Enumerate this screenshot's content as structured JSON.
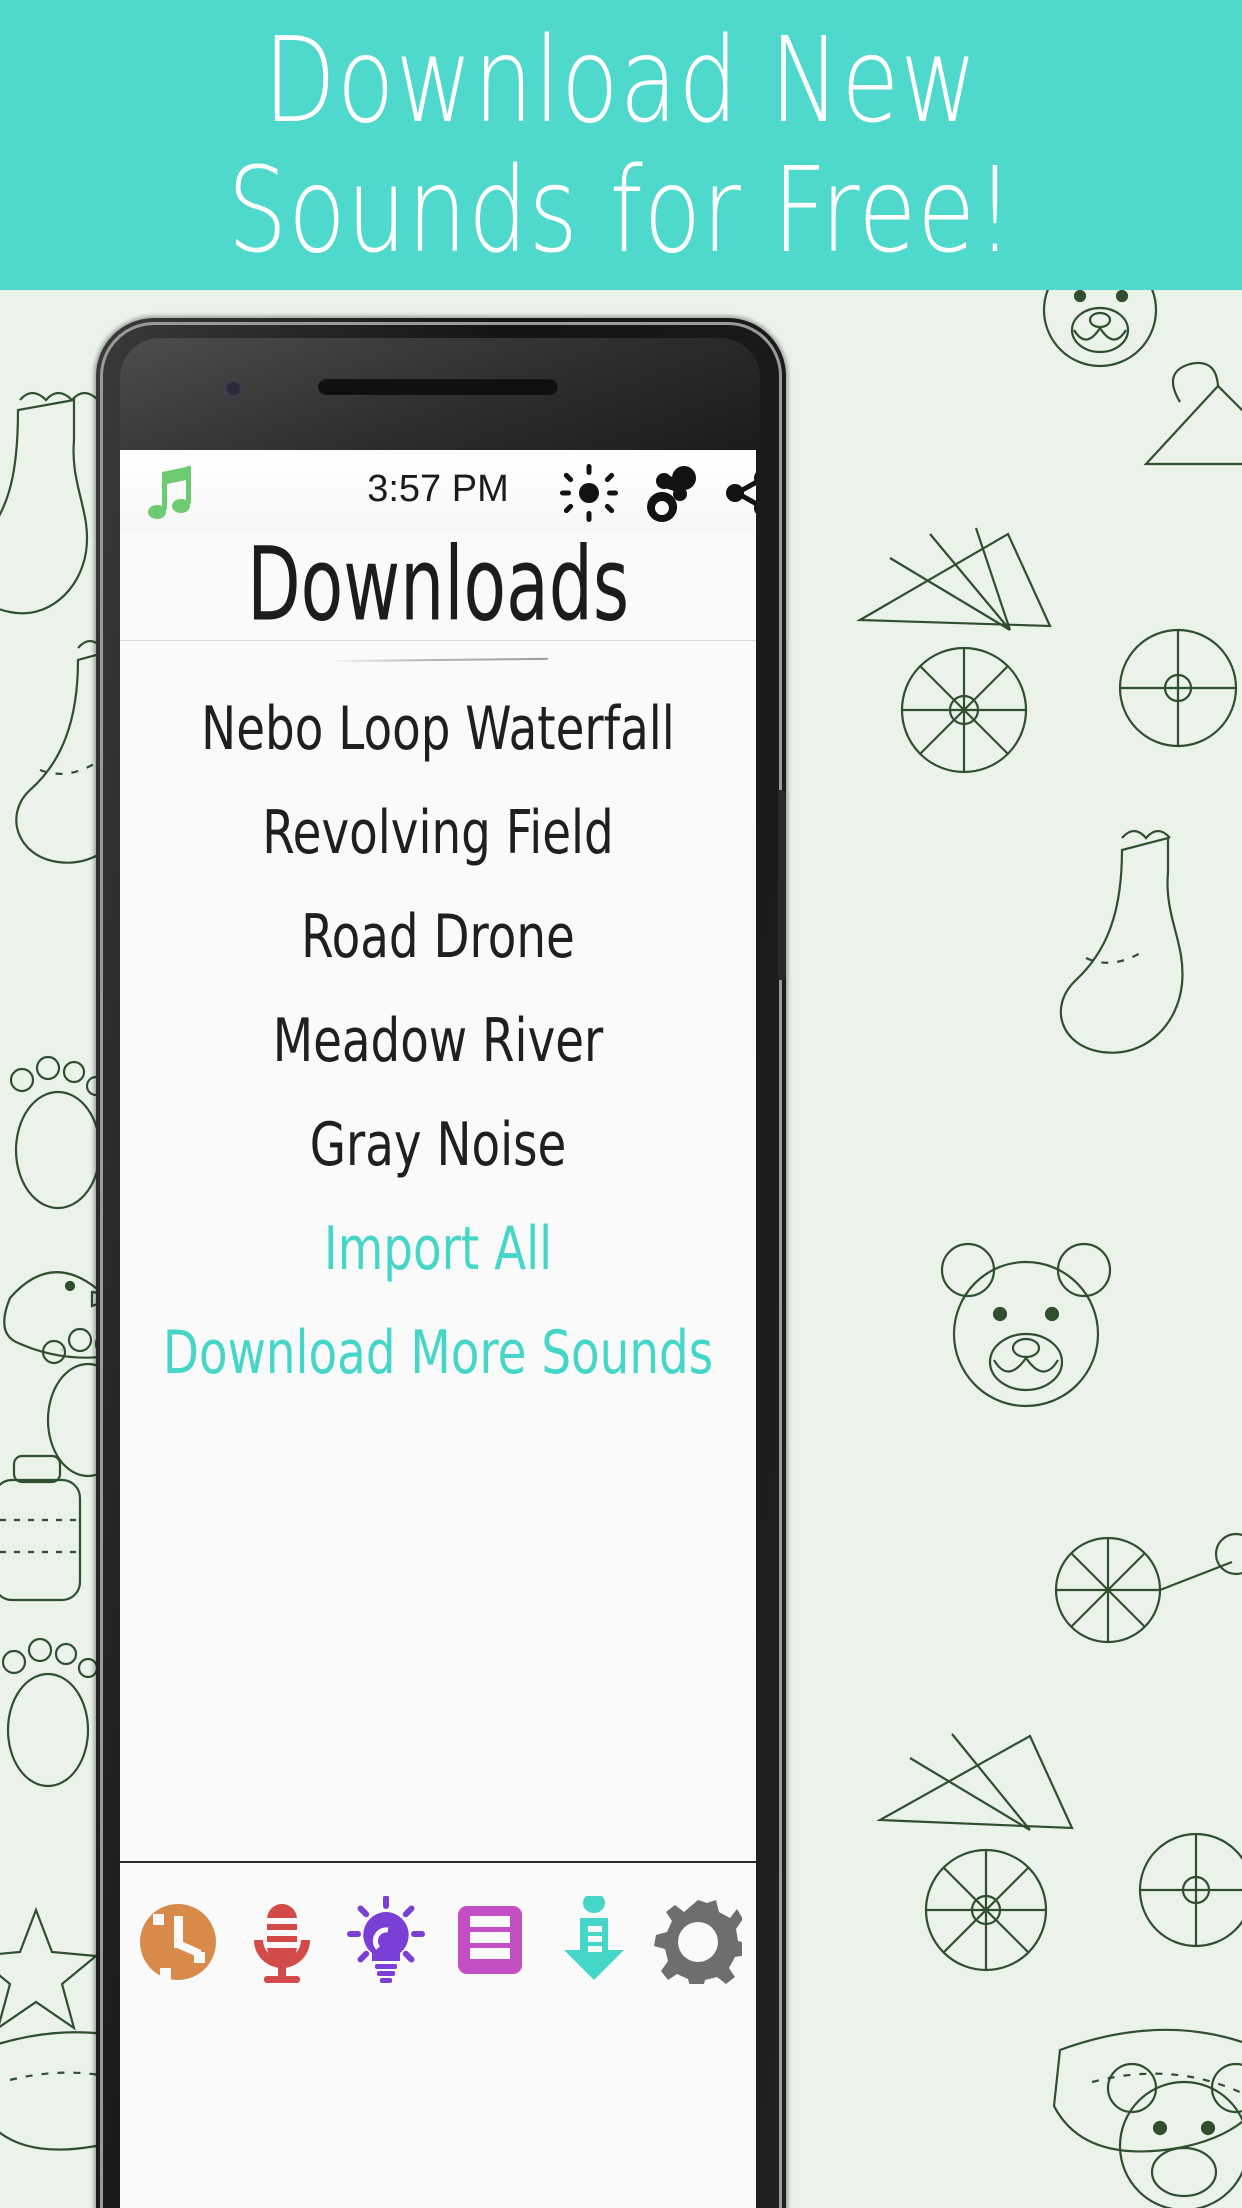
{
  "promo": {
    "line1": "Download New",
    "line2": "Sounds for Free!",
    "bg_color": "#4FD8CC",
    "text_color": "#FFFFFF"
  },
  "background": {
    "color": "#EAF2EA",
    "doodle_stroke": "#2F4F2F",
    "motifs": [
      "baby-sock",
      "teddy-bear",
      "stroller",
      "duck",
      "rattle",
      "footprint",
      "baby-bottle",
      "star"
    ]
  },
  "phone": {
    "status_bar": {
      "time": "3:57 PM",
      "left_icon": "music-note-icon",
      "left_icon_color": "#6FCB72",
      "right_icons": [
        "brightness-icon",
        "pacifier-icon",
        "share-icon"
      ]
    },
    "header": {
      "title": "Downloads"
    },
    "list": {
      "items": [
        {
          "label": "Nebo Loop Waterfall",
          "type": "sound"
        },
        {
          "label": "Revolving Field",
          "type": "sound"
        },
        {
          "label": "Road Drone",
          "type": "sound"
        },
        {
          "label": "Meadow River",
          "type": "sound"
        },
        {
          "label": "Gray Noise",
          "type": "sound"
        },
        {
          "label": "Import All",
          "type": "link"
        },
        {
          "label": "Download More Sounds",
          "type": "link"
        }
      ],
      "link_color": "#45D6C8",
      "text_color": "#1F1F1F"
    },
    "toolbar": {
      "buttons": [
        {
          "name": "timer-clock-icon",
          "label": "Timer",
          "color": "#D88A4A"
        },
        {
          "name": "microphone-icon",
          "label": "Record",
          "color": "#D24A4A"
        },
        {
          "name": "lightbulb-icon",
          "label": "Night Light",
          "color": "#7B3FD6"
        },
        {
          "name": "playlist-icon",
          "label": "Playlist",
          "color": "#C44FC4"
        },
        {
          "name": "download-icon",
          "label": "Downloads",
          "color": "#45D6C8"
        },
        {
          "name": "settings-gear-icon",
          "label": "Settings",
          "color": "#6E6E6E"
        }
      ]
    }
  }
}
